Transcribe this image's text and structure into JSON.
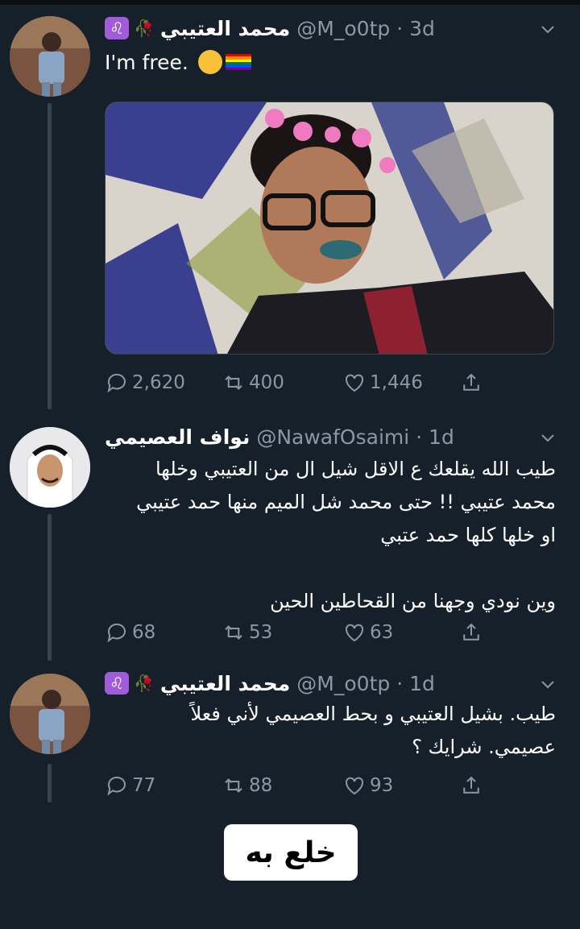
{
  "tweets": [
    {
      "display_name": "محمد العتيبي",
      "handle": "@M_o0tp",
      "time": "3d",
      "text": "I'm free.",
      "badge_icon": "leo-zodiac-icon",
      "counts": {
        "reply": "2,620",
        "retweet": "400",
        "like": "1,446"
      }
    },
    {
      "display_name": "نواف العصيمي",
      "handle": "@NawafOsaimi",
      "time": "1d",
      "text_lines": [
        "طيب الله يقلعك ع الاقل شيل ال من العتيبي وخلها",
        "محمد عتيبي !! حتى محمد شل الميم منها حمد عتيبي",
        "او خلها كلها حمد عتبي",
        "",
        "وين نودي وجهنا من القحاطين الحين"
      ],
      "counts": {
        "reply": "68",
        "retweet": "53",
        "like": "63"
      }
    },
    {
      "display_name": "محمد العتيبي",
      "handle": "@M_o0tp",
      "time": "1d",
      "text_lines": [
        "طيب. بشيل العتيبي و بحط العصيمي لأني فعلاً",
        "عصيمي. شرايك ؟"
      ],
      "counts": {
        "reply": "77",
        "retweet": "88",
        "like": "93"
      }
    }
  ],
  "caption": "خلع به",
  "colors": {
    "background": "#15202b",
    "muted": "#8899a6",
    "badge": "#a05bd8"
  }
}
